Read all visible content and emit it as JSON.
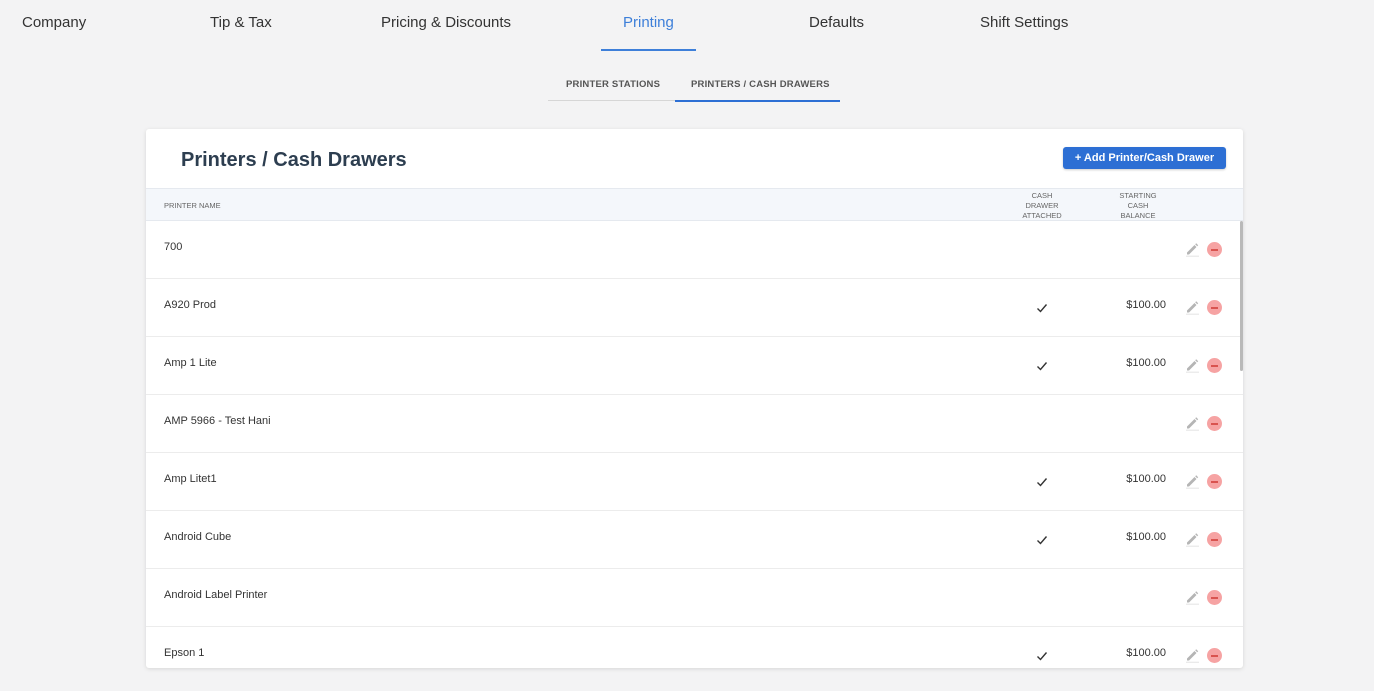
{
  "top_tabs": [
    {
      "label": "Company",
      "active": false
    },
    {
      "label": "Tip & Tax",
      "active": false
    },
    {
      "label": "Pricing & Discounts",
      "active": false
    },
    {
      "label": "Printing",
      "active": true
    },
    {
      "label": "Defaults",
      "active": false
    },
    {
      "label": "Shift Settings",
      "active": false
    }
  ],
  "sub_tabs": [
    {
      "label": "PRINTER STATIONS",
      "active": false
    },
    {
      "label": "PRINTERS / CASH DRAWERS",
      "active": true
    }
  ],
  "card": {
    "title": "Printers / Cash Drawers",
    "add_button_label": "+ Add Printer/Cash Drawer"
  },
  "table": {
    "headers": {
      "name": "PRINTER NAME",
      "cash_drawer_line1": "CASH",
      "cash_drawer_line2": "DRAWER",
      "cash_drawer_line3": "ATTACHED",
      "balance_line1": "STARTING",
      "balance_line2": "CASH",
      "balance_line3": "BALANCE"
    },
    "rows": [
      {
        "name": "700",
        "cash_drawer": false,
        "balance": ""
      },
      {
        "name": "A920 Prod",
        "cash_drawer": true,
        "balance": "$100.00"
      },
      {
        "name": "Amp 1 Lite",
        "cash_drawer": true,
        "balance": "$100.00"
      },
      {
        "name": "AMP 5966 - Test Hani",
        "cash_drawer": false,
        "balance": ""
      },
      {
        "name": "Amp Litet1",
        "cash_drawer": true,
        "balance": "$100.00"
      },
      {
        "name": "Android Cube",
        "cash_drawer": true,
        "balance": "$100.00"
      },
      {
        "name": "Android Label Printer",
        "cash_drawer": false,
        "balance": ""
      },
      {
        "name": "Epson 1",
        "cash_drawer": true,
        "balance": "$100.00"
      }
    ]
  },
  "colors": {
    "accent": "#3d7fd9",
    "button": "#2d6fd4",
    "delete": "#f6a3a3"
  },
  "icons": {
    "check": "check-icon",
    "edit": "pencil-icon",
    "delete": "minus-circle-icon"
  }
}
